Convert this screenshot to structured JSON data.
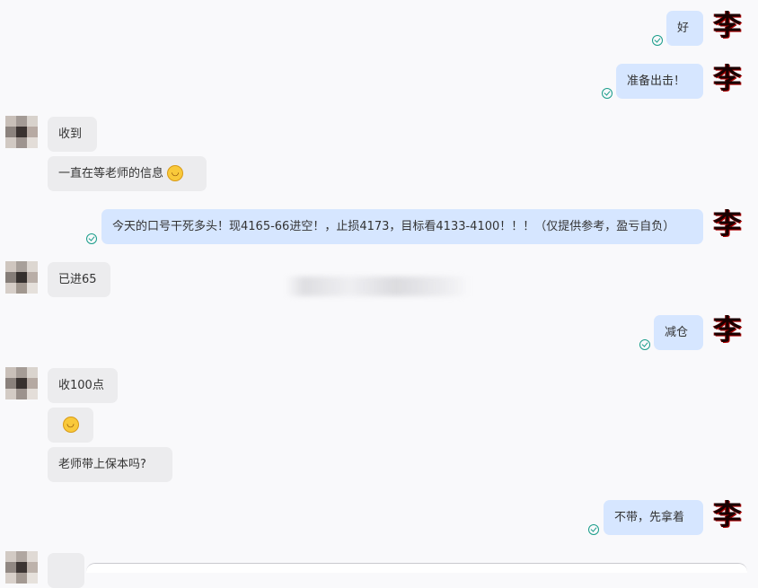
{
  "sender_avatar_char": "李",
  "emoji_glyph": "◡",
  "colors": {
    "outgoing_bubble": "#d6e6ff",
    "incoming_bubble": "#ececee",
    "read_check": "#1a9d8a",
    "background": "#f9f9fb"
  },
  "messages": [
    {
      "direction": "outgoing",
      "text": "好",
      "status_icon": "read-check-icon"
    },
    {
      "direction": "outgoing",
      "text": "准备出击！",
      "status_icon": "read-check-icon"
    },
    {
      "direction": "incoming",
      "text": "收到"
    },
    {
      "direction": "incoming",
      "text": "一直在等老师的信息",
      "emoji": "grinning-face-icon"
    },
    {
      "direction": "outgoing",
      "text": "今天的口号干死多头！现4165-66进空！，止损4173，目标看4133-4100！！！（仅提供参考，盈亏自负）",
      "status_icon": "read-check-icon"
    },
    {
      "direction": "incoming",
      "text": "已进65"
    },
    {
      "direction": "outgoing",
      "text": "减仓",
      "status_icon": "read-check-icon"
    },
    {
      "direction": "incoming",
      "text": "收100点"
    },
    {
      "direction": "incoming",
      "text": "",
      "emoji": "grinning-face-icon"
    },
    {
      "direction": "incoming",
      "text": "老师带上保本吗?"
    },
    {
      "direction": "outgoing",
      "text": "不带，先拿着",
      "status_icon": "read-check-icon"
    }
  ]
}
